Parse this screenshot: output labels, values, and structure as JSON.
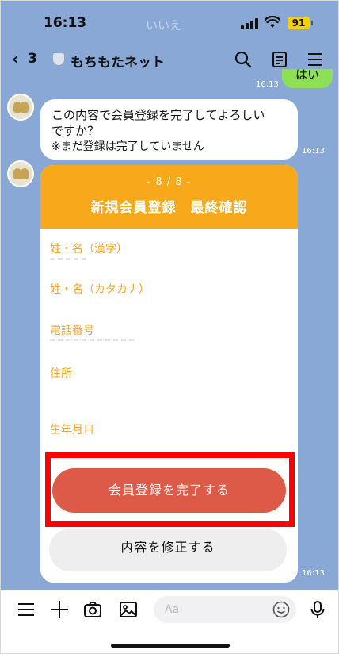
{
  "status_bar": {
    "time": "16:13",
    "center_text": "いいえ",
    "battery": "91"
  },
  "header": {
    "back_count": "3",
    "title": "もちもたネット"
  },
  "messages": {
    "my_reply": {
      "text": "はい",
      "time": "16:13"
    },
    "confirm": {
      "line1": "この内容で会員登録を完了してよろしい",
      "line2": "ですか？",
      "note": "※まだ登録は完了していません",
      "time": "16:13"
    },
    "card": {
      "step": "- 8 / 8 -",
      "title": "新規会員登録　最終確認",
      "fields": [
        "姓・名（漢字）",
        "姓・名（カタカナ）",
        "電話番号",
        "住所",
        "生年月日"
      ],
      "primary_button": "会員登録を完了する",
      "secondary_button": "内容を修正する",
      "time": "16:13"
    }
  },
  "input_bar": {
    "placeholder": "Aa"
  },
  "colors": {
    "chat_bg": "#8aa8d6",
    "card_header": "#f7a91b",
    "primary_button": "#dd5a48",
    "highlight": "#ff0000",
    "my_bubble": "#8de055"
  }
}
